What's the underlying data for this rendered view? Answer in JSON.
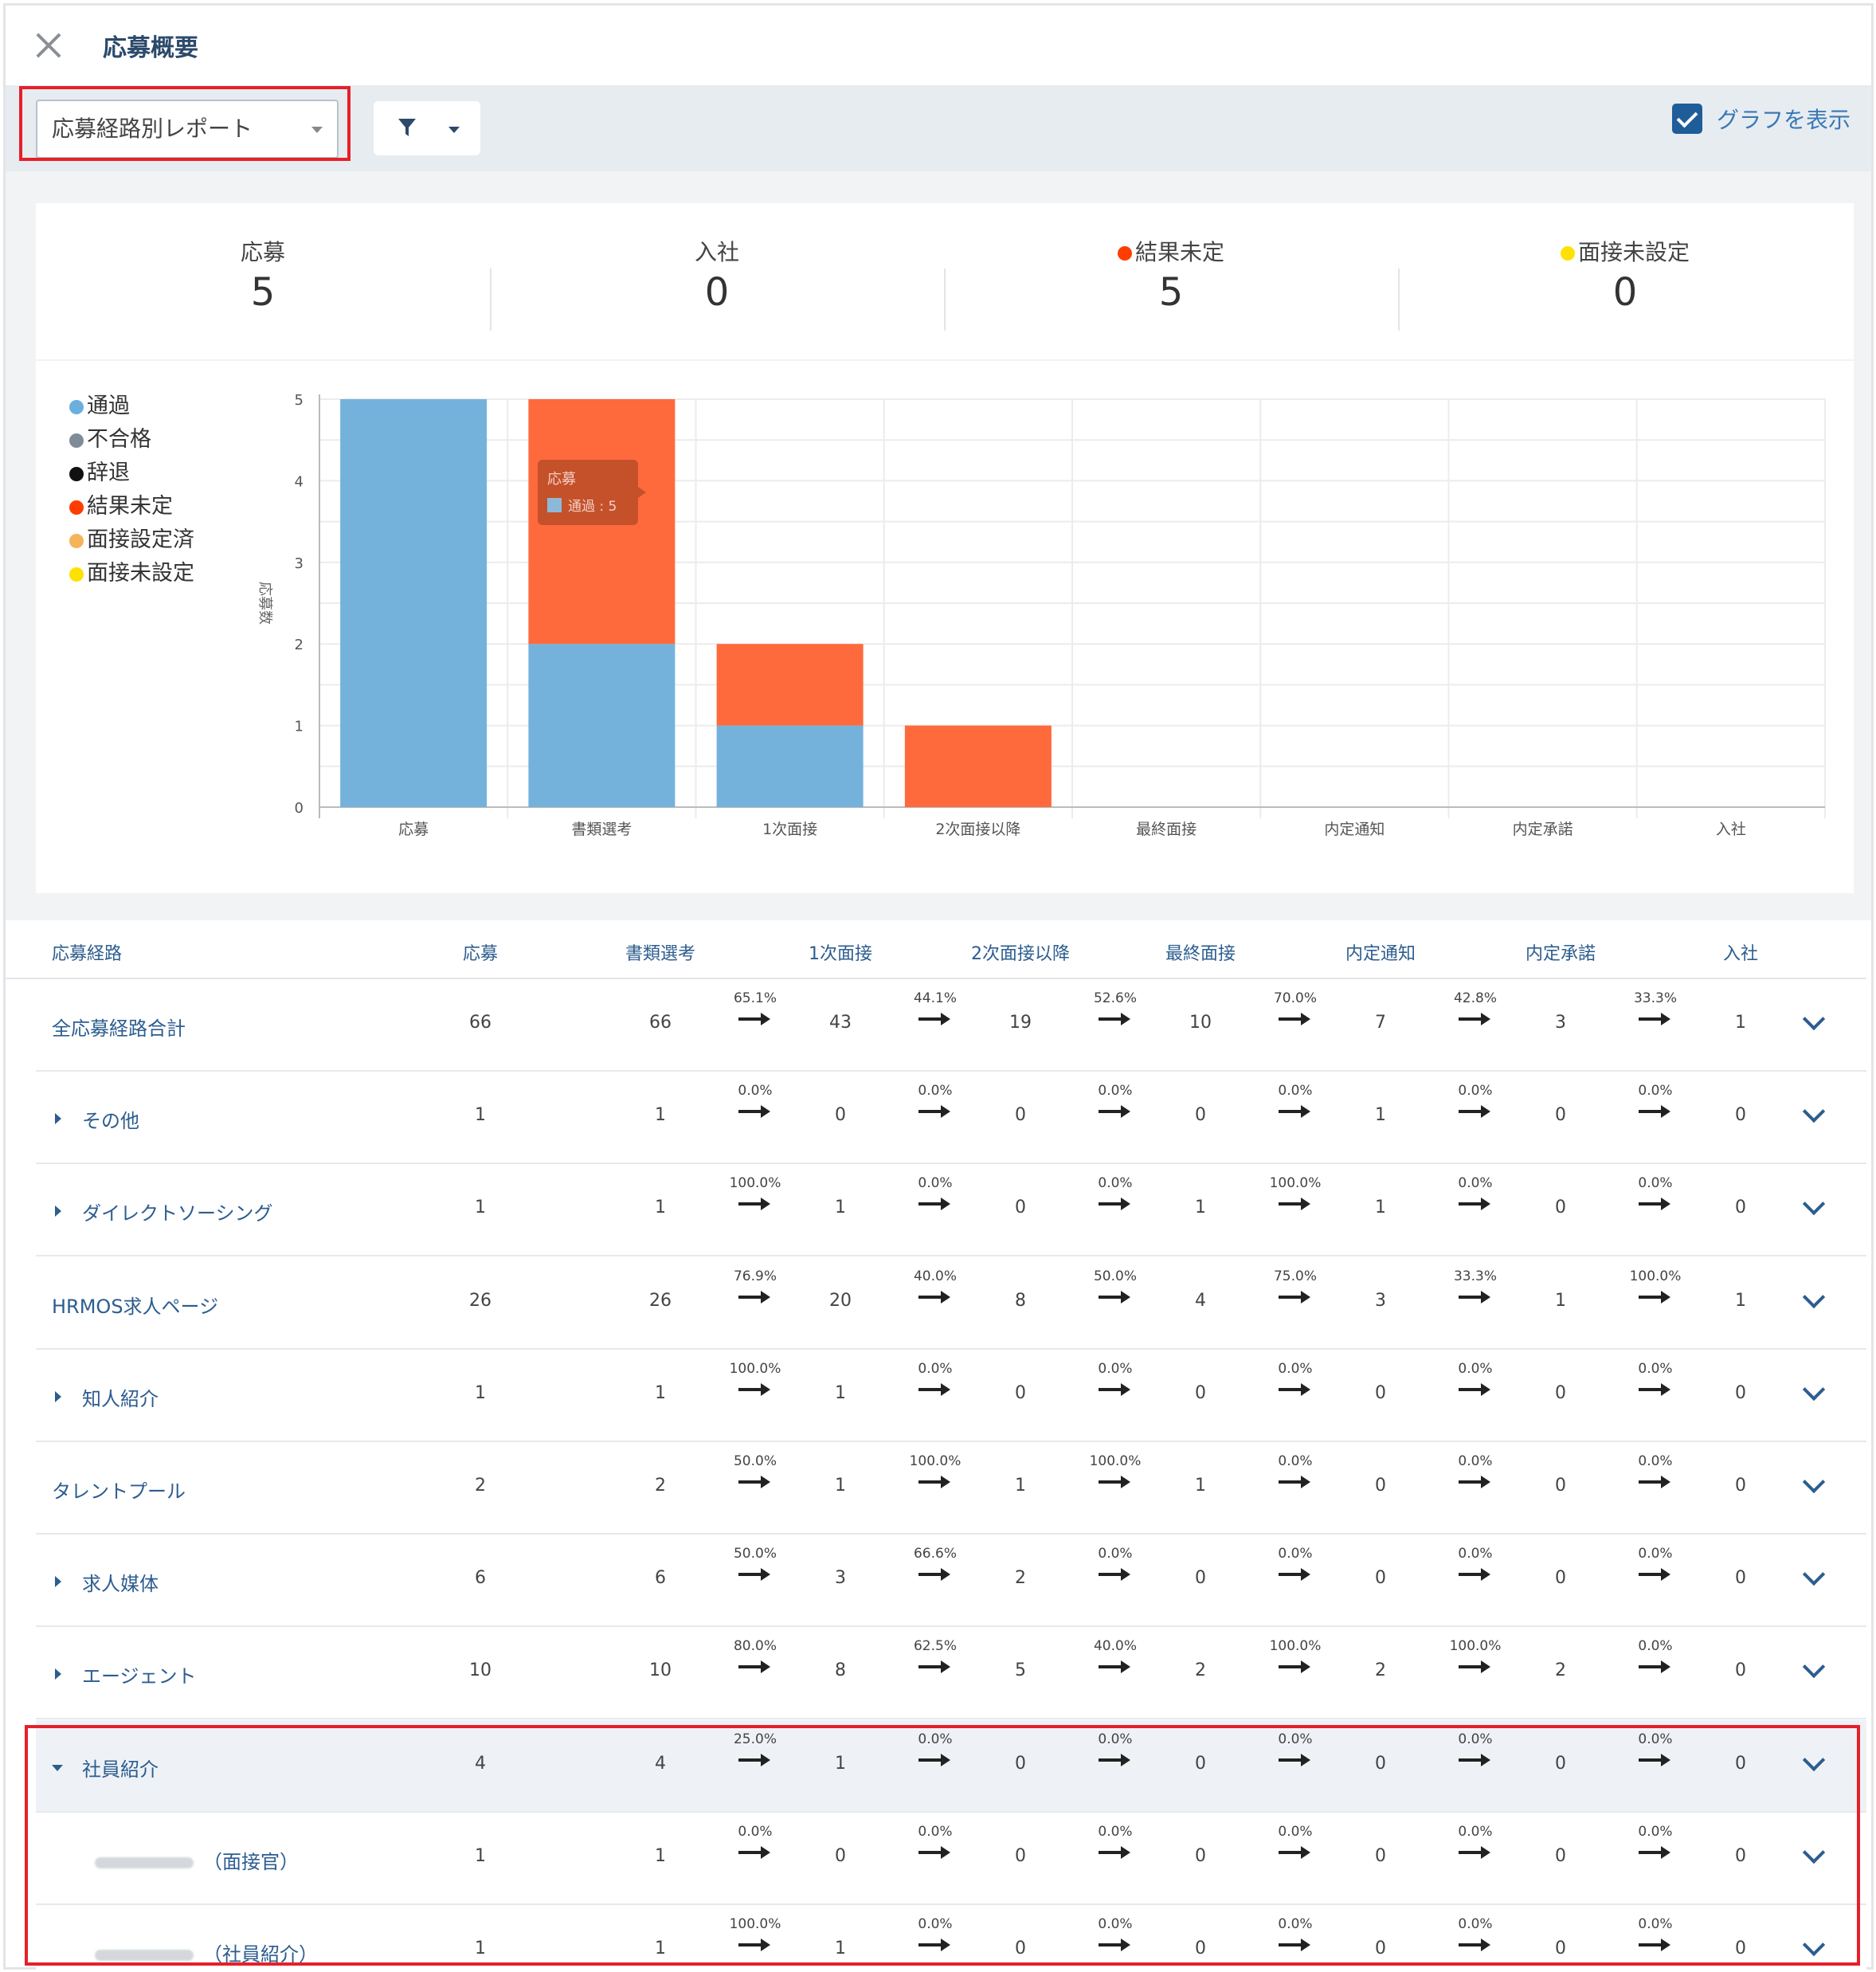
{
  "header": {
    "title": "応募概要"
  },
  "toolbar": {
    "report_select_value": "応募経路別レポート",
    "graph_toggle_label": "グラフを表示"
  },
  "summary": [
    {
      "label": "応募",
      "value": "5"
    },
    {
      "label": "入社",
      "value": "0"
    },
    {
      "label": "結果未定",
      "value": "5",
      "dot_color": "#ff3d00"
    },
    {
      "label": "面接未設定",
      "value": "0",
      "dot_color": "#ffe100"
    }
  ],
  "legend": [
    {
      "label": "通過",
      "color": "#6ab0de"
    },
    {
      "label": "不合格",
      "color": "#7f8c98"
    },
    {
      "label": "辞退",
      "color": "#111111"
    },
    {
      "label": "結果未定",
      "color": "#ff3d00"
    },
    {
      "label": "面接設定済",
      "color": "#f5b45a"
    },
    {
      "label": "面接未設定",
      "color": "#ffe100"
    }
  ],
  "chart_data": {
    "type": "bar",
    "stacked": true,
    "categories": [
      "応募",
      "書類選考",
      "1次面接",
      "2次面接以降",
      "最終面接",
      "内定通知",
      "内定承諾",
      "入社"
    ],
    "series": [
      {
        "name": "通過",
        "color": "#74b2dc",
        "values": [
          5,
          2,
          1,
          0,
          0,
          0,
          0,
          0
        ]
      },
      {
        "name": "結果未定",
        "color": "#ff6a3d",
        "values": [
          0,
          3,
          1,
          1,
          0,
          0,
          0,
          0
        ]
      }
    ],
    "ylabel": "応募数",
    "ylim": [
      0,
      5
    ],
    "yticks": [
      0,
      1,
      2,
      3,
      4,
      5
    ],
    "grid": true,
    "tooltip": {
      "title": "応募",
      "text": "通過 : 5"
    }
  },
  "table": {
    "headers": [
      "応募経路",
      "応募",
      "書類選考",
      "1次面接",
      "2次面接以降",
      "最終面接",
      "内定通知",
      "内定承諾",
      "入社"
    ],
    "rows": [
      {
        "name": "全応募経路合計",
        "expander": "none",
        "values": [
          "66",
          "66",
          "43",
          "19",
          "10",
          "7",
          "3",
          "1"
        ],
        "rates": [
          "65.1%",
          "44.1%",
          "52.6%",
          "70.0%",
          "42.8%",
          "33.3%"
        ]
      },
      {
        "name": "その他",
        "expander": "closed",
        "values": [
          "1",
          "1",
          "0",
          "0",
          "0",
          "1",
          "0",
          "0"
        ],
        "rates": [
          "0.0%",
          "0.0%",
          "0.0%",
          "0.0%",
          "0.0%",
          "0.0%"
        ]
      },
      {
        "name": "ダイレクトソーシング",
        "expander": "closed",
        "values": [
          "1",
          "1",
          "1",
          "0",
          "1",
          "1",
          "0",
          "0"
        ],
        "rates": [
          "100.0%",
          "0.0%",
          "0.0%",
          "100.0%",
          "0.0%",
          "0.0%"
        ]
      },
      {
        "name": "HRMOS求人ページ",
        "expander": "none",
        "values": [
          "26",
          "26",
          "20",
          "8",
          "4",
          "3",
          "1",
          "1"
        ],
        "rates": [
          "76.9%",
          "40.0%",
          "50.0%",
          "75.0%",
          "33.3%",
          "100.0%"
        ]
      },
      {
        "name": "知人紹介",
        "expander": "closed",
        "values": [
          "1",
          "1",
          "1",
          "0",
          "0",
          "0",
          "0",
          "0"
        ],
        "rates": [
          "100.0%",
          "0.0%",
          "0.0%",
          "0.0%",
          "0.0%",
          "0.0%"
        ]
      },
      {
        "name": "タレントプール",
        "expander": "none",
        "values": [
          "2",
          "2",
          "1",
          "1",
          "1",
          "0",
          "0",
          "0"
        ],
        "rates": [
          "50.0%",
          "100.0%",
          "100.0%",
          "0.0%",
          "0.0%",
          "0.0%"
        ]
      },
      {
        "name": "求人媒体",
        "expander": "closed",
        "values": [
          "6",
          "6",
          "3",
          "2",
          "0",
          "0",
          "0",
          "0"
        ],
        "rates": [
          "50.0%",
          "66.6%",
          "0.0%",
          "0.0%",
          "0.0%",
          "0.0%"
        ]
      },
      {
        "name": "エージェント",
        "expander": "closed",
        "values": [
          "10",
          "10",
          "8",
          "5",
          "2",
          "2",
          "2",
          "0"
        ],
        "rates": [
          "80.0%",
          "62.5%",
          "40.0%",
          "100.0%",
          "100.0%",
          "0.0%"
        ]
      },
      {
        "name": "社員紹介",
        "expander": "open",
        "selected": true,
        "values": [
          "4",
          "4",
          "1",
          "0",
          "0",
          "0",
          "0",
          "0"
        ],
        "rates": [
          "25.0%",
          "0.0%",
          "0.0%",
          "0.0%",
          "0.0%",
          "0.0%"
        ]
      },
      {
        "name": "（面接官）",
        "expander": "none",
        "sub": true,
        "values": [
          "1",
          "1",
          "0",
          "0",
          "0",
          "0",
          "0",
          "0"
        ],
        "rates": [
          "0.0%",
          "0.0%",
          "0.0%",
          "0.0%",
          "0.0%",
          "0.0%"
        ]
      },
      {
        "name": "（社員紹介）",
        "expander": "none",
        "sub": true,
        "values": [
          "1",
          "1",
          "1",
          "0",
          "0",
          "0",
          "0",
          "0"
        ],
        "rates": [
          "100.0%",
          "0.0%",
          "0.0%",
          "0.0%",
          "0.0%",
          "0.0%"
        ]
      }
    ]
  }
}
